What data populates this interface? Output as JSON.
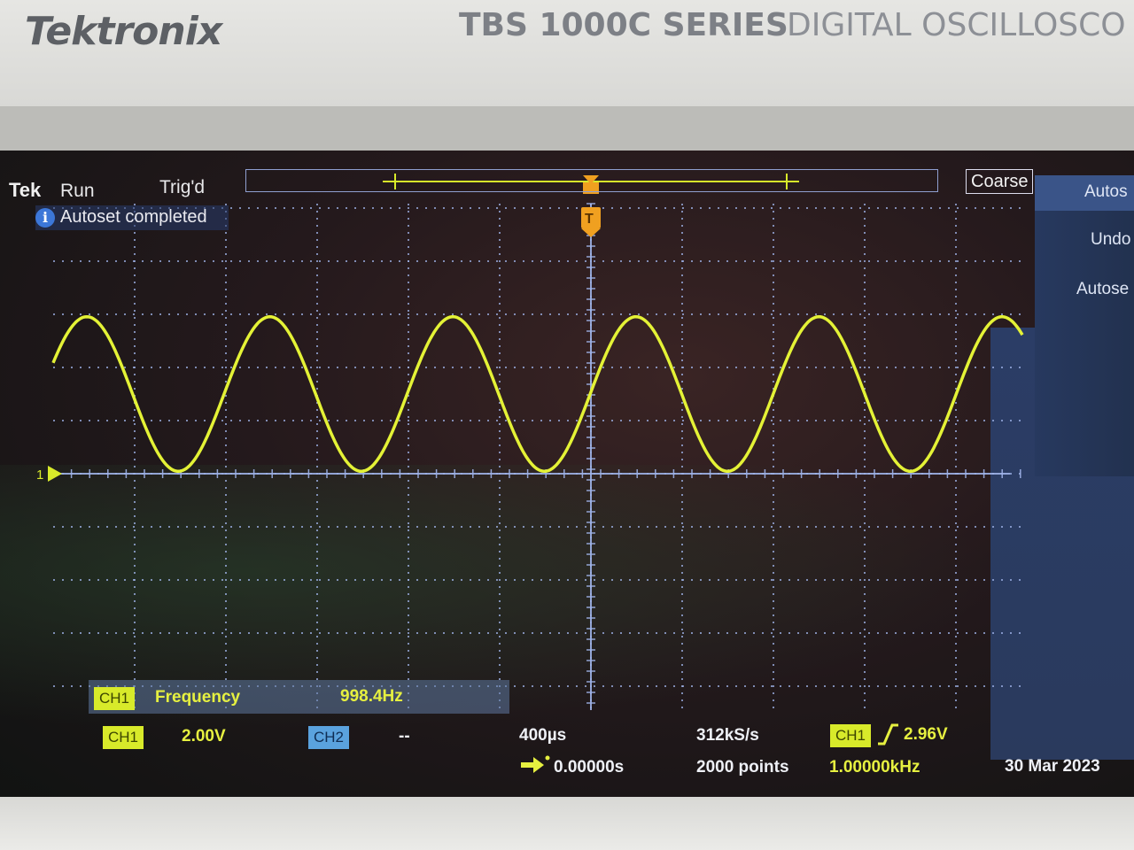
{
  "bezel": {
    "brand": "Tektronix",
    "series": "TBS 1000C SERIES",
    "description": "DIGITAL OSCILLOSCO"
  },
  "status": {
    "logo": "Tek",
    "acquisition": "Run",
    "trigger_state": "Trig'd",
    "knob_mode": "Coarse",
    "message": "Autoset completed",
    "info_icon": "i"
  },
  "side_menu": {
    "title": "Autos",
    "items": [
      "Undo",
      "Autose"
    ]
  },
  "trigger_marker": "T",
  "channel_marker": "1",
  "measurement": {
    "channel": "CH1",
    "name": "Frequency",
    "value": "998.4Hz"
  },
  "readouts": {
    "ch1_label": "CH1",
    "ch1_scale": "2.00V",
    "ch2_label": "CH2",
    "ch2_scale": "--",
    "time_scale": "400µs",
    "sample_rate": "312kS/s",
    "trigger_channel": "CH1",
    "trigger_level": "2.96V",
    "horizontal_position": "0.00000s",
    "record_length": "2000 points",
    "trigger_frequency": "1.00000kHz",
    "date": "30 Mar 2023"
  },
  "icons": {
    "info": "info-icon",
    "trigger": "trigger-position-icon",
    "rising_edge": "rising-edge-icon",
    "position_arrow": "position-arrow-icon"
  },
  "colors": {
    "ch1": "#d8ea2a",
    "ch2": "#5aa2de",
    "trace": "#e4f236",
    "trigger": "#f0a020",
    "graticule": "#9fb3e8"
  },
  "waveform": {
    "type": "sine",
    "frequency_hz": 998.4,
    "cycles_visible": 5.3,
    "amplitude_divisions": 3.0,
    "offset_divisions": 1.5
  }
}
